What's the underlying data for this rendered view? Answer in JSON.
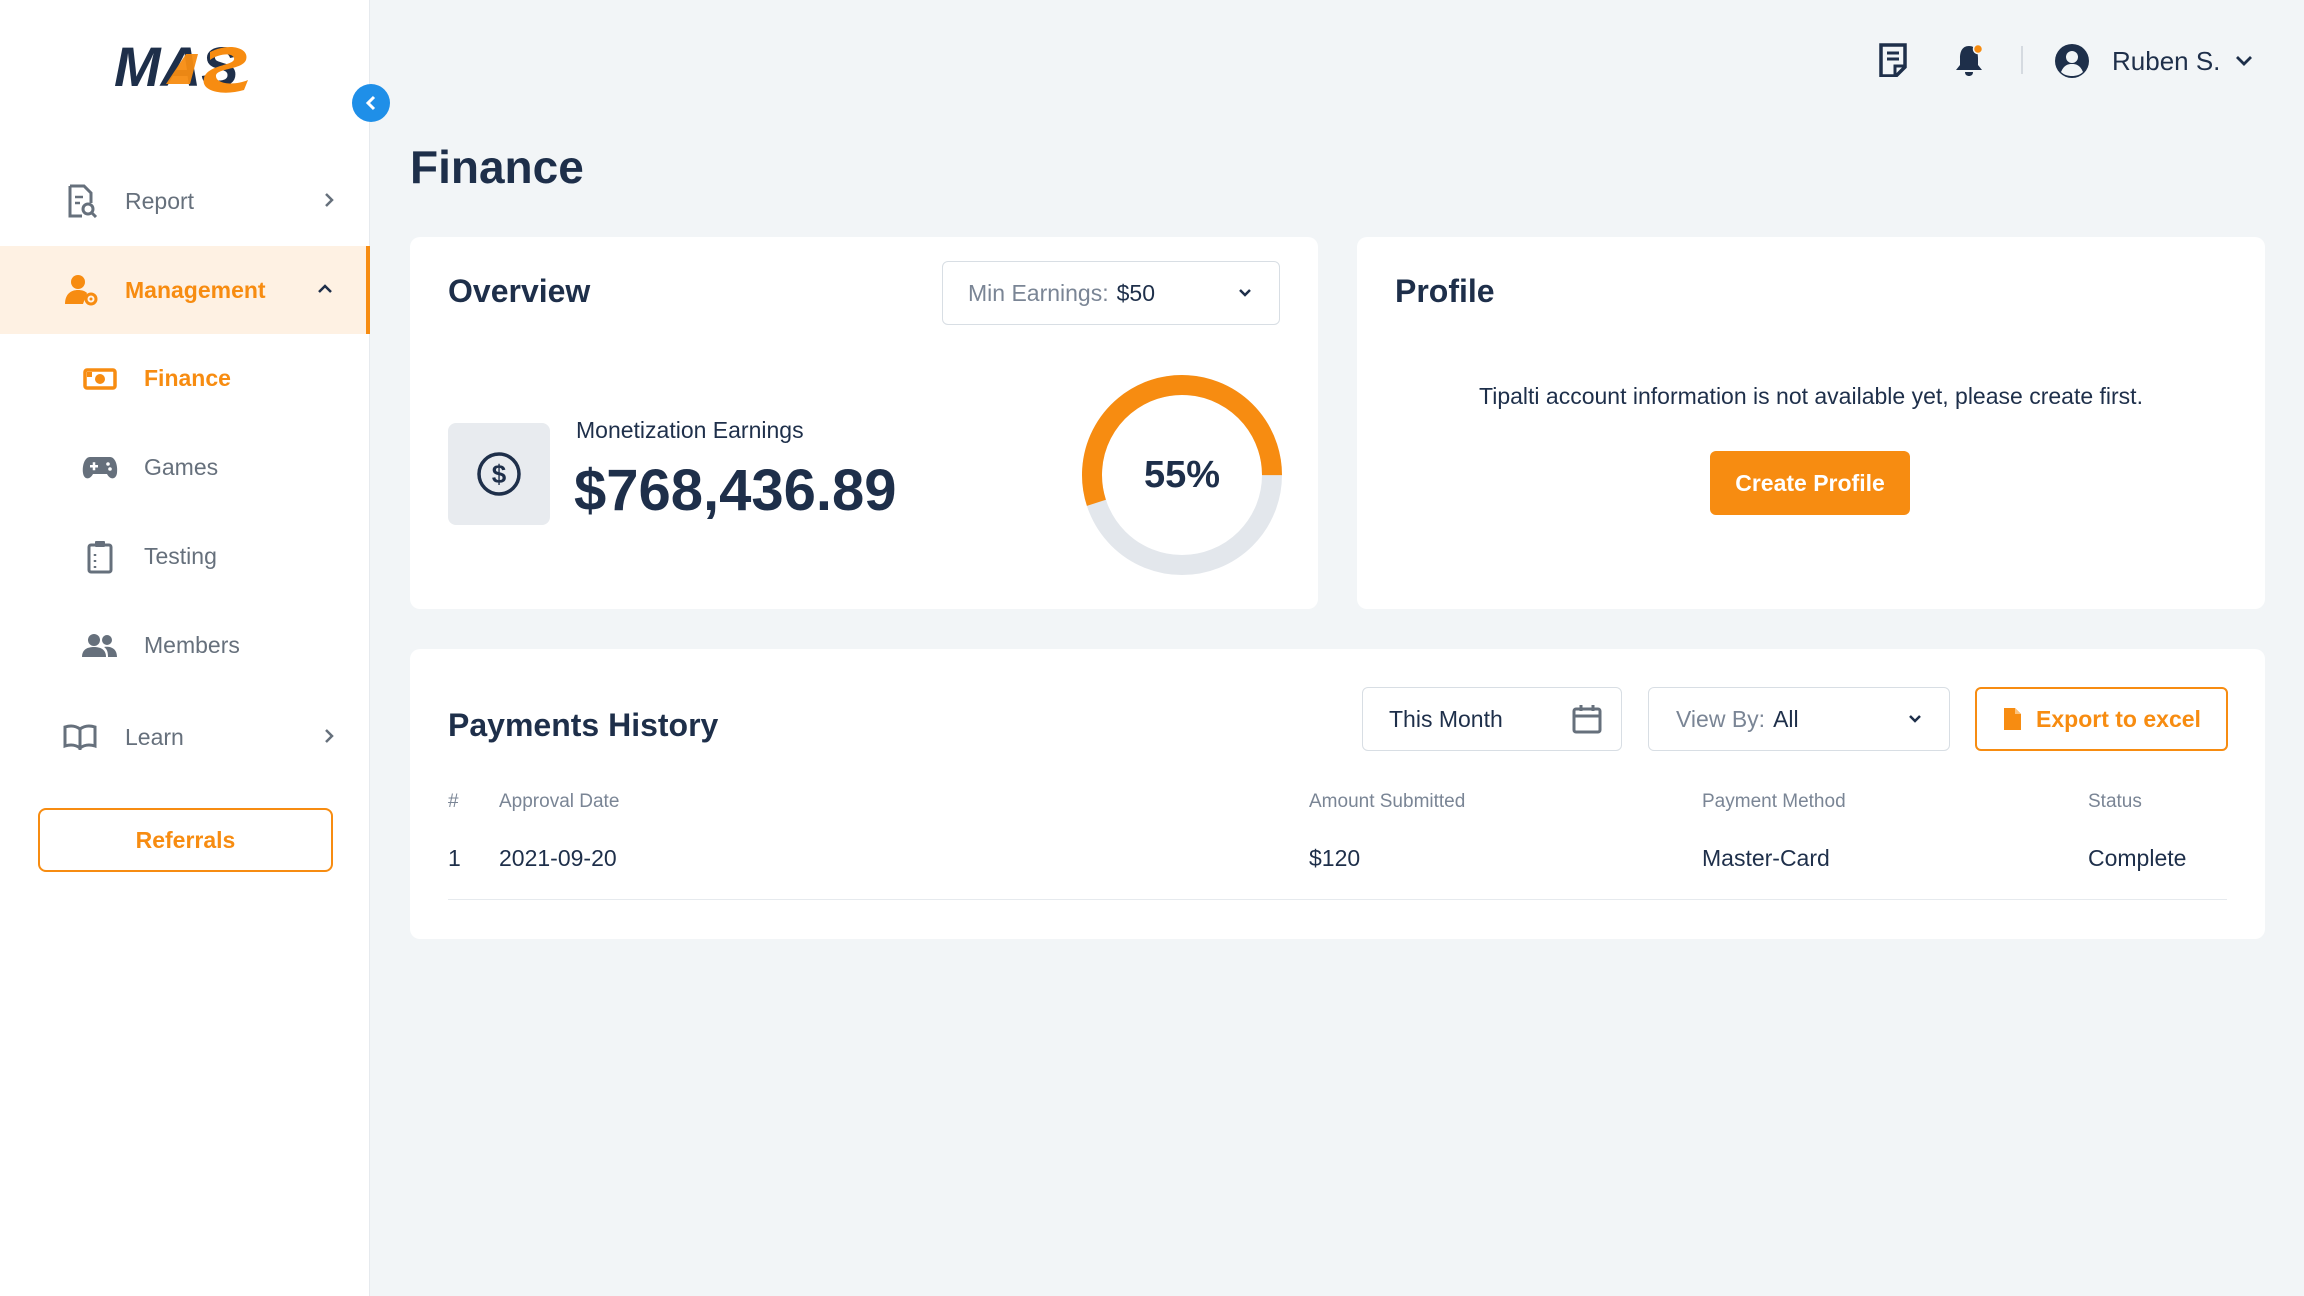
{
  "brand": {
    "logo_text": "MAS"
  },
  "sidebar": {
    "items": [
      {
        "label": "Report"
      },
      {
        "label": "Management"
      },
      {
        "label": "Learn"
      }
    ],
    "management_sub": [
      {
        "label": "Finance"
      },
      {
        "label": "Games"
      },
      {
        "label": "Testing"
      },
      {
        "label": "Members"
      }
    ],
    "referrals_label": "Referrals"
  },
  "header": {
    "user_name": "Ruben S."
  },
  "page": {
    "title": "Finance"
  },
  "overview": {
    "title": "Overview",
    "filter_prefix": "Min Earnings:",
    "filter_value": "$50",
    "earnings_label": "Monetization Earnings",
    "earnings_value": "$768,436.89",
    "progress_percent": 55,
    "progress_label": "55%"
  },
  "profile": {
    "title": "Profile",
    "message": "Tipalti account information is not available yet, please create first.",
    "create_button": "Create Profile"
  },
  "payments": {
    "title": "Payments History",
    "date_filter": "This Month",
    "view_by_prefix": "View By:",
    "view_by_value": "All",
    "export_label": "Export to excel",
    "columns": [
      "#",
      "Approval Date",
      "Amount Submitted",
      "Payment Method",
      "Status"
    ],
    "rows": [
      {
        "num": "1",
        "date": "2021-09-20",
        "amount": "$120",
        "method": "Master-Card",
        "status": "Complete"
      }
    ]
  },
  "colors": {
    "accent": "#f78c11",
    "primary_text": "#1e2f4a",
    "blue": "#1f8fe8",
    "track": "#e3e7ec"
  }
}
